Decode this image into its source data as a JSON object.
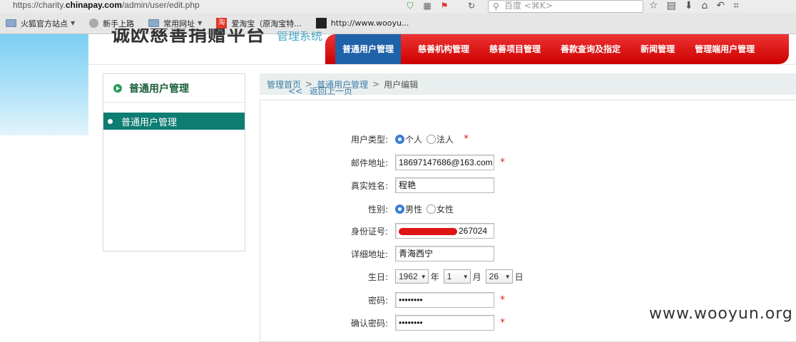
{
  "browser": {
    "url_prefix": "https://charity.",
    "url_domain": "chinapay.com",
    "url_path": "/admin/user/edit.php",
    "search_placeholder": "百度 <⌘K>"
  },
  "bookmarks": [
    {
      "label": "火狐官方站点",
      "icon": "folder-icon",
      "dropdown": true
    },
    {
      "label": "新手上路",
      "icon": "globe-icon",
      "dropdown": false
    },
    {
      "label": "常用网址",
      "icon": "folder-icon",
      "dropdown": true
    },
    {
      "label": "爱淘宝（原淘宝特...",
      "icon": "taobao-icon",
      "dropdown": false
    },
    {
      "label": "http://www.wooyu...",
      "icon": "wooyun-icon",
      "dropdown": false
    }
  ],
  "header": {
    "logo_text": "诚欧慈善捐赠平台",
    "logo_sub": "管理系统",
    "nav": [
      {
        "label": "普通用户管理",
        "active": true
      },
      {
        "label": "慈善机构管理",
        "active": false
      },
      {
        "label": "慈善项目管理",
        "active": false
      },
      {
        "label": "善款查询及指定",
        "active": false
      },
      {
        "label": "新闻管理",
        "active": false
      },
      {
        "label": "管理端用户管理",
        "active": false
      }
    ]
  },
  "sidebar": {
    "title": "普通用户管理",
    "items": [
      {
        "label": "普通用户管理",
        "selected": true
      }
    ]
  },
  "breadcrumb": {
    "home": "管理首页",
    "section": "普通用户管理",
    "current": "用户编辑",
    "separator": ">"
  },
  "form": {
    "back_label": "返回上一页",
    "user_type": {
      "label": "用户类型:",
      "options": [
        "个人",
        "法人"
      ],
      "selected": "个人"
    },
    "email": {
      "label": "邮件地址:",
      "value": "18697147686@163.com"
    },
    "real_name": {
      "label": "真实姓名:",
      "value": "程艳"
    },
    "gender": {
      "label": "性别:",
      "options": [
        "男性",
        "女性"
      ],
      "selected": "男性"
    },
    "id_number": {
      "label": "身份证号:",
      "visible_suffix": "267024"
    },
    "address": {
      "label": "详细地址:",
      "value": "青海西宁"
    },
    "birthday": {
      "label": "生日:",
      "year": "1962",
      "year_unit": "年",
      "month": "1",
      "month_unit": "月",
      "day": "26",
      "day_unit": "日"
    },
    "password": {
      "label": "密码:",
      "value": "••••••••"
    },
    "confirm_password": {
      "label": "确认密码:",
      "value": "••••••••"
    },
    "required_mark": "*"
  },
  "watermark": "www.wooyun.org",
  "colors": {
    "nav_red": "#cc0000",
    "nav_active_blue": "#1f62a8",
    "sidebar_teal": "#0e7d72",
    "link_blue": "#3d7fa8",
    "required_red": "#dd2222"
  }
}
